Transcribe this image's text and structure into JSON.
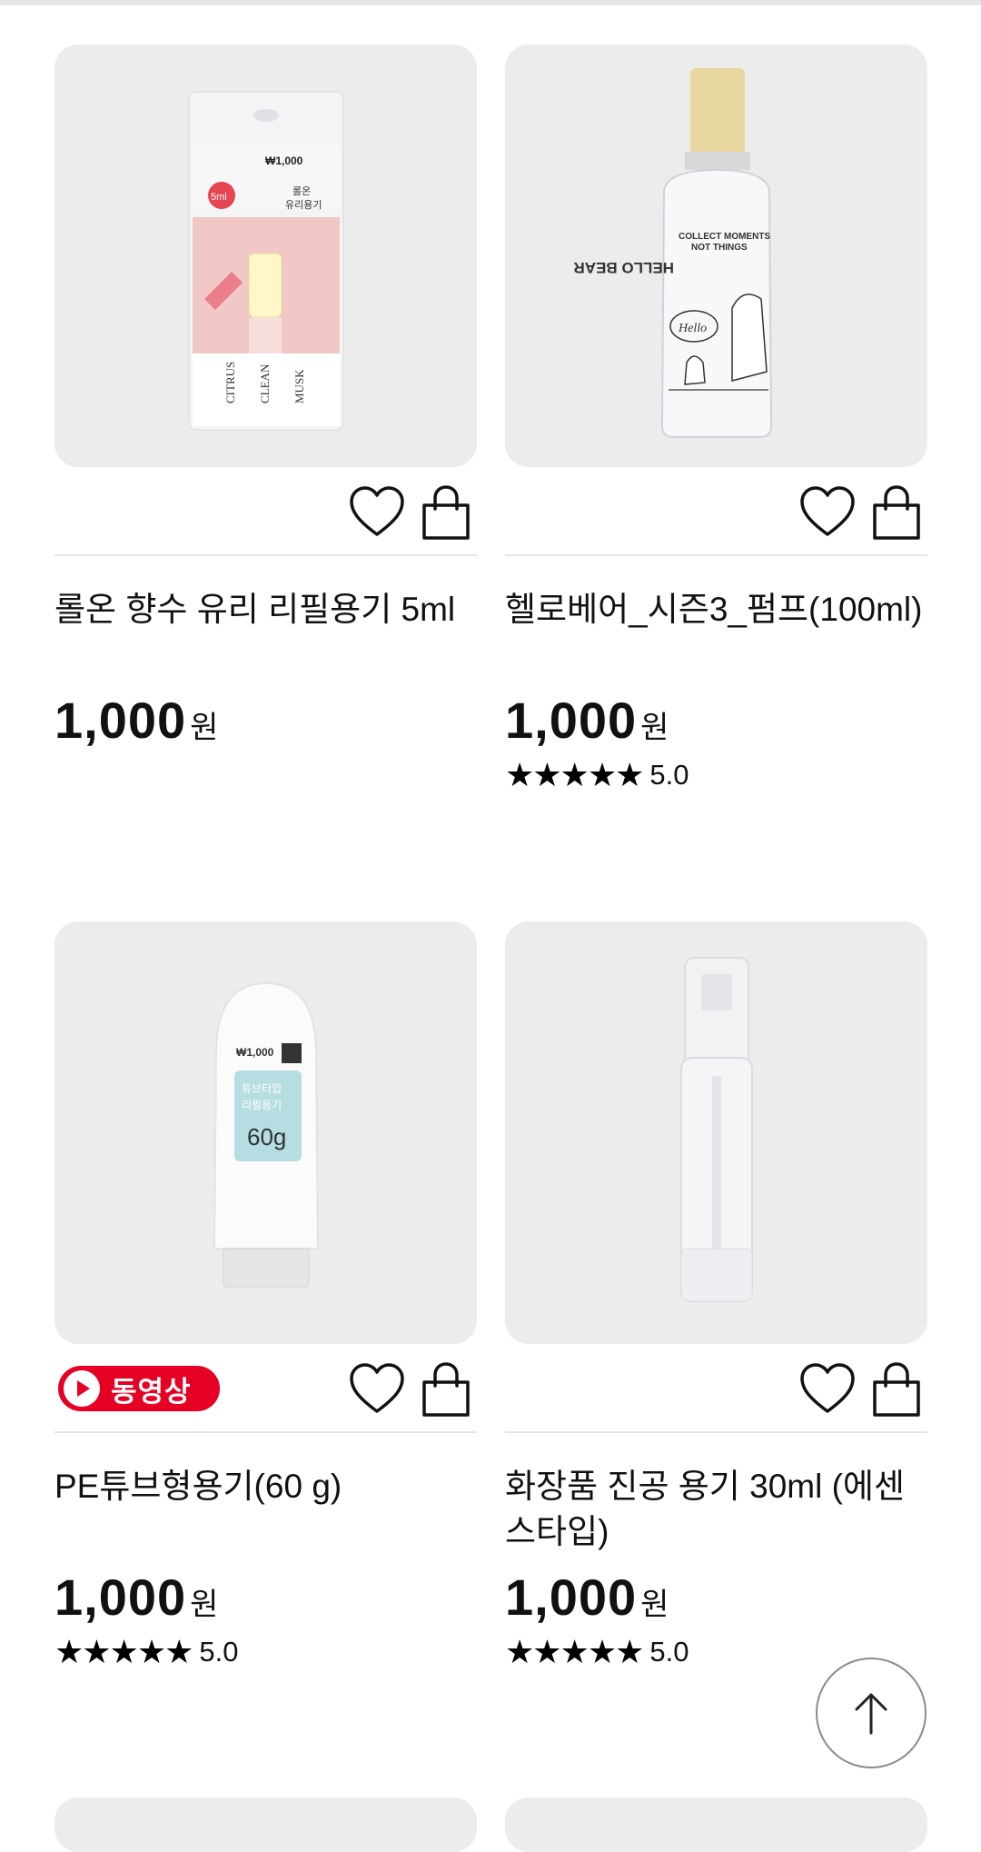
{
  "products": [
    {
      "name": "롤온 향수 유리 리필용기 5ml",
      "price": "1,000",
      "currency": "원",
      "rating_stars": "★★★★★",
      "rating_value": "",
      "has_video": false,
      "image": "rollon-perfume-glass-container",
      "package_text": {
        "price_tag": "₩1,000",
        "title": "롤온\n유리용기",
        "size": "5ml"
      }
    },
    {
      "name": "헬로베어_시즌3_펌프(100ml)",
      "price": "1,000",
      "currency": "원",
      "rating_stars": "★★★★★",
      "rating_value": "5.0",
      "has_video": false,
      "image": "hello-bear-pump-bottle",
      "package_text": {
        "line1": "COLLECT MOMENTS",
        "line2": "NOT THINGS",
        "line3": "HELLO BEAR",
        "bubble": "Hello"
      }
    },
    {
      "name": "PE튜브형용기(60 g)",
      "price": "1,000",
      "currency": "원",
      "rating_stars": "★★★★★",
      "rating_value": "5.0",
      "has_video": true,
      "video_label": "동영상",
      "image": "pe-tube-container",
      "package_text": {
        "price_tag": "₩1,000",
        "title": "튜브타입\n리필용기",
        "size": "60g"
      }
    },
    {
      "name": "화장품 진공 용기 30ml (에센스타입)",
      "price": "1,000",
      "currency": "원",
      "rating_stars": "★★★★★",
      "rating_value": "5.0",
      "has_video": false,
      "image": "vacuum-cosmetic-container"
    }
  ],
  "icons": {
    "wishlist": "heart-outline-icon",
    "cart": "shopping-bag-icon",
    "play": "play-icon",
    "scroll_top": "arrow-up-icon"
  },
  "colors": {
    "badge": "#e60023",
    "thumb_bg": "#ececec",
    "divider": "#e4e4e4"
  }
}
